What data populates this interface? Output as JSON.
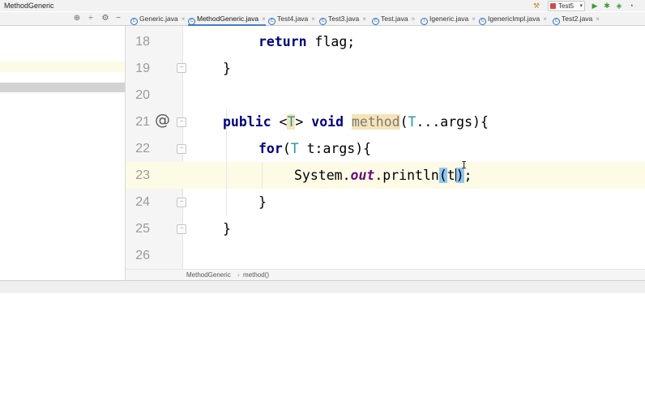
{
  "window": {
    "title": "MethodGeneric"
  },
  "toolbar": {
    "run_config": "Test5",
    "icons": [
      "hammer-icon",
      "run-icon",
      "debug-icon",
      "coverage-icon",
      "profile-icon"
    ]
  },
  "tabs": [
    {
      "label": "Generic.java",
      "active": false
    },
    {
      "label": "MethodGeneric.java",
      "active": true
    },
    {
      "label": "Test4.java",
      "active": false
    },
    {
      "label": "Test3.java",
      "active": false
    },
    {
      "label": "Test.java",
      "active": false
    },
    {
      "label": "Igeneric.java",
      "active": false
    },
    {
      "label": "IgenericImpl.java",
      "active": false
    },
    {
      "label": "Test2.java",
      "active": false
    }
  ],
  "editor": {
    "line_numbers": [
      "18",
      "19",
      "20",
      "21",
      "22",
      "23",
      "24",
      "25",
      "26"
    ],
    "current_line": "23",
    "code": {
      "l18_kw": "return",
      "l18_rest": " flag;",
      "l19": "}",
      "l21_public": "public",
      "l21_lt": " <",
      "l21_T": "T",
      "l21_gt": "> ",
      "l21_void": "void",
      "l21_sp": " ",
      "l21_method": "method",
      "l21_paren": "(",
      "l21_T2": "T",
      "l21_rest": "...args){",
      "l22_for": "for",
      "l22_paren": "(",
      "l22_T": "T",
      "l22_rest": " t:args){",
      "l23_system": "System.",
      "l23_out": "out",
      "l23_println": ".println",
      "l23_open": "(",
      "l23_t": "t",
      "l23_close": ")",
      "l23_semi": ";",
      "l24": "}",
      "l25": "}"
    }
  },
  "breadcrumb": {
    "class_name": "MethodGeneric",
    "separator": "›",
    "method_name": "method()"
  },
  "colors": {
    "keyword": "#000080",
    "type_param": "#20999d",
    "static_field": "#660e7a",
    "current_line": "#fdfbe6",
    "brace_match": "#93c6ef",
    "usage_highlight": "#f5e4b6"
  }
}
